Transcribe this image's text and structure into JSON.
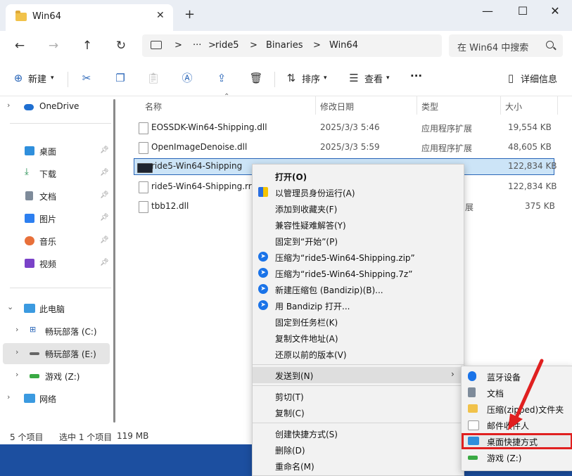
{
  "window": {
    "tab_title": "Win64",
    "close_tab": "✕",
    "new_tab": "+",
    "minimize": "—",
    "maximize": "☐",
    "close": "✕"
  },
  "nav": {
    "back": "←",
    "forward": "→",
    "up": "↑",
    "refresh": "↻",
    "breadcrumb": [
      ">",
      "···",
      ">",
      "ride5",
      ">",
      "Binaries",
      ">",
      "Win64"
    ],
    "search_placeholder": "在 Win64 中搜索"
  },
  "toolbar": {
    "new_label": "新建",
    "sort_label": "排序",
    "view_label": "查看",
    "more_label": "···",
    "details_label": "详细信息"
  },
  "sidebar": {
    "onedrive": "OneDrive",
    "quick": [
      "桌面",
      "下载",
      "文档",
      "图片",
      "音乐",
      "视频"
    ],
    "this_pc": "此电脑",
    "drives": [
      "畅玩部落 (C:)",
      "畅玩部落 (E:)",
      "游戏 (Z:)"
    ],
    "network": "网络"
  },
  "columns": {
    "name": "名称",
    "modified": "修改日期",
    "type": "类型",
    "size": "大小"
  },
  "files": [
    {
      "name": "EOSSDK-Win64-Shipping.dll",
      "modified": "2025/3/3 5:46",
      "type": "应用程序扩展",
      "size": "19,554 KB"
    },
    {
      "name": "OpenImageDenoise.dll",
      "modified": "2025/3/3 5:59",
      "type": "应用程序扩展",
      "size": "48,605 KB"
    },
    {
      "name": "ride5-Win64-Shipping",
      "modified": "",
      "type": "",
      "size": "122,834 KB"
    },
    {
      "name": "ride5-Win64-Shipping.rr",
      "modified": "",
      "type": "",
      "size": "122,834 KB"
    },
    {
      "name": "tbb12.dll",
      "modified": "",
      "type": "展",
      "size": "375 KB"
    }
  ],
  "status": {
    "count": "5 个项目",
    "selected": "选中 1 个项目",
    "size": "119 MB"
  },
  "context_menu": {
    "items": [
      "打开(O)",
      "以管理员身份运行(A)",
      "添加到收藏夹(F)",
      "兼容性疑难解答(Y)",
      "固定到“开始”(P)",
      "压缩为“ride5-Win64-Shipping.zip”",
      "压缩为“ride5-Win64-Shipping.7z”",
      "新建压缩包 (Bandizip)(B)...",
      "用 Bandizip 打开...",
      "固定到任务栏(K)",
      "复制文件地址(A)",
      "还原以前的版本(V)",
      "发送到(N)",
      "剪切(T)",
      "复制(C)",
      "创建快捷方式(S)",
      "删除(D)",
      "重命名(M)"
    ],
    "submenu_arrow": "›"
  },
  "send_to_menu": {
    "items": [
      "蓝牙设备",
      "文档",
      "压缩(zipped)文件夹",
      "邮件收件人",
      "桌面快捷方式",
      "游戏 (Z:)"
    ]
  },
  "colors": {
    "accent": "#2a66b8",
    "selection": "#cce4f7",
    "annotation": "#e02020"
  }
}
